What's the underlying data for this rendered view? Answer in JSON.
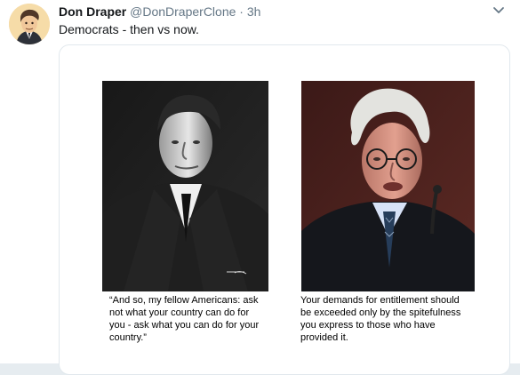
{
  "tweet": {
    "author_name": "Don Draper",
    "author_handle": "@DonDraperClone",
    "separator": "·",
    "timestamp": "3h",
    "text": "Democrats - then vs now.",
    "icons": {
      "avatar": "cartoon-man-avatar",
      "menu": "chevron-down-icon"
    }
  },
  "media": {
    "left_caption": "“And so, my fellow Americans: ask\nnot what your country can do for\nyou - ask what you can do for your\ncountry.”",
    "right_caption": "Your demands for entitlement should\nbe exceeded only by the spitefulness\nyou express to those who have\nprovided it."
  },
  "colors": {
    "name": "#14171a",
    "secondary": "#657786",
    "border": "#e1e8ed"
  }
}
